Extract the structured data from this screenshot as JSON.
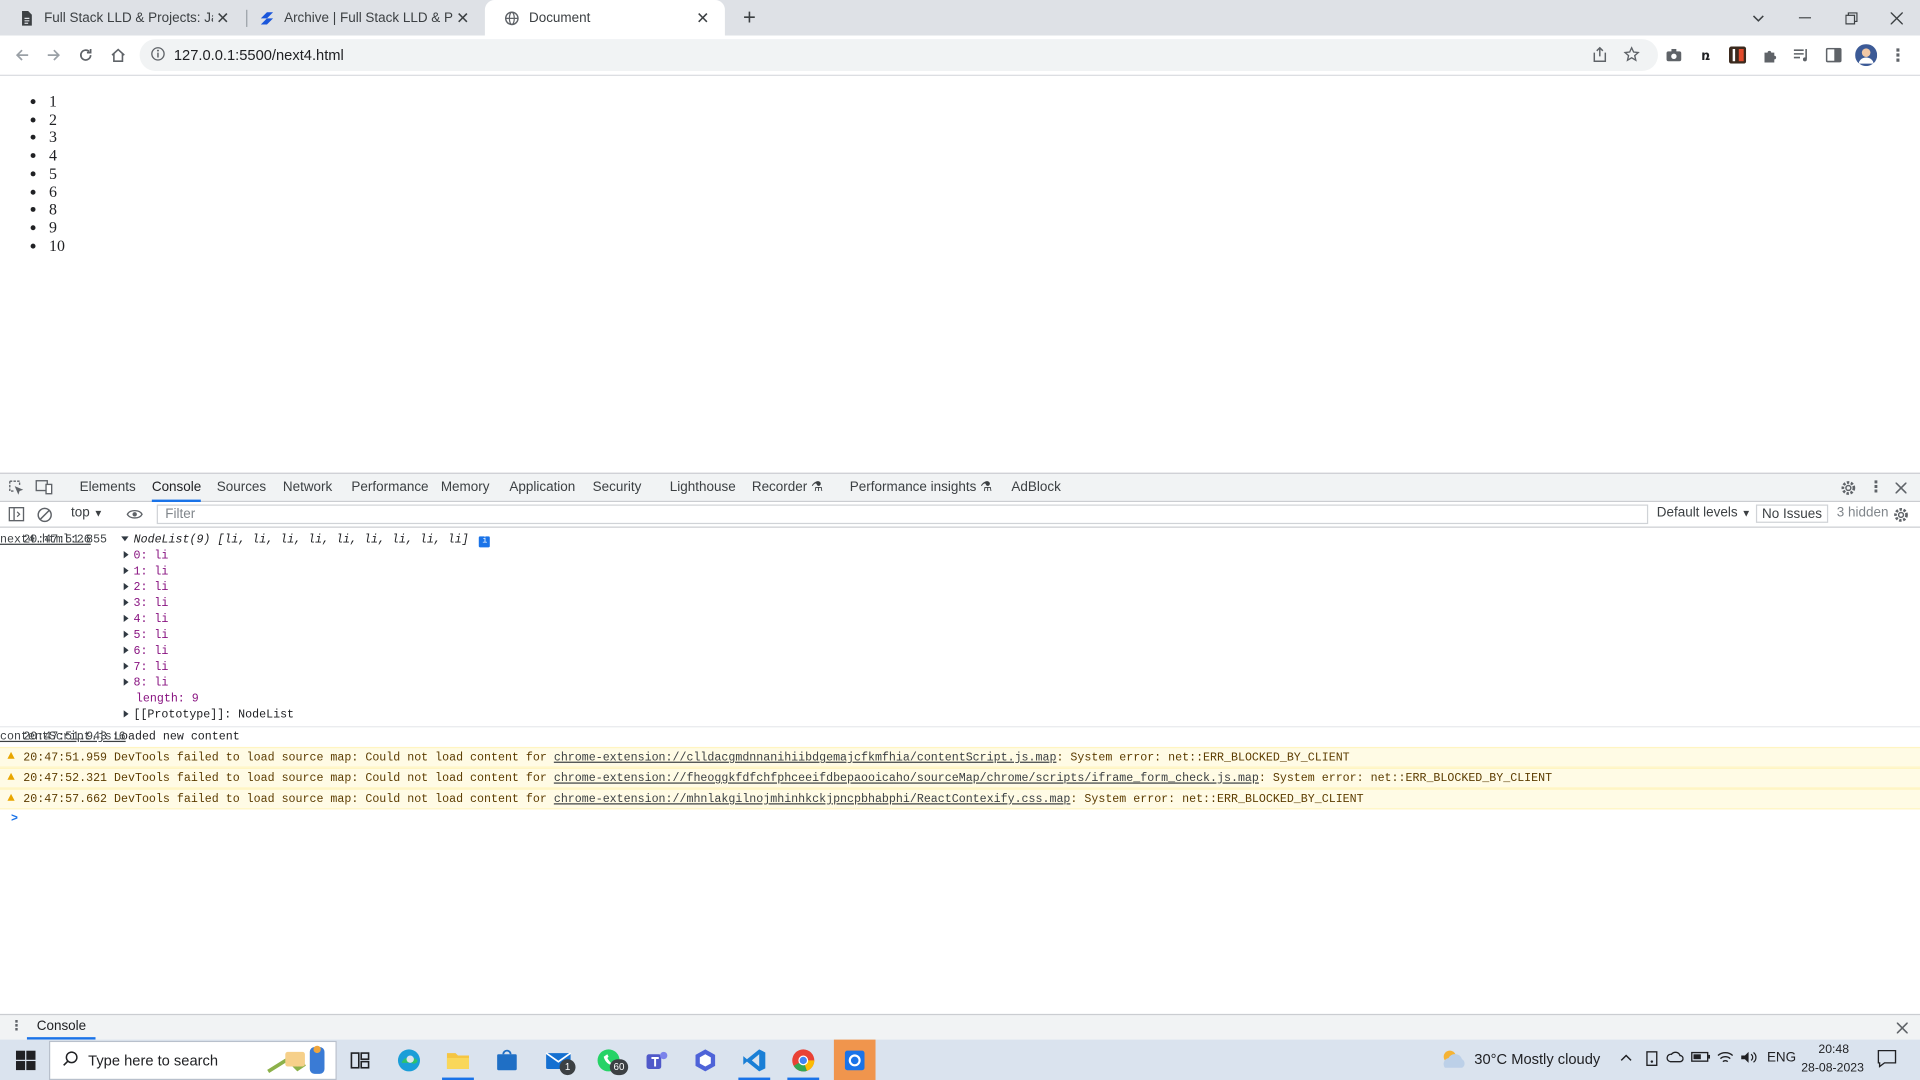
{
  "browser": {
    "tabs": [
      {
        "title": "Full Stack LLD & Projects: JavaScript",
        "icon": "document-icon"
      },
      {
        "title": "Archive | Full Stack LLD & Projects",
        "icon": "scaler-icon"
      },
      {
        "title": "Document",
        "icon": "globe-icon"
      }
    ],
    "url": "127.0.0.1:5500/next4.html"
  },
  "page": {
    "list_items": [
      "1",
      "2",
      "3",
      "4",
      "5",
      "6",
      "8",
      "9",
      "10"
    ]
  },
  "devtools": {
    "tabs": [
      "Elements",
      "Console",
      "Sources",
      "Network",
      "Performance",
      "Memory",
      "Application",
      "Security",
      "Lighthouse",
      "Recorder",
      "Performance insights",
      "AdBlock"
    ],
    "active_tab": "Console",
    "context": "top",
    "filter_placeholder": "Filter",
    "levels": "Default levels",
    "issues": "No Issues",
    "hidden": "3 hidden",
    "drawer_tab": "Console"
  },
  "console": {
    "nodelist": {
      "time": "20:47:51.855",
      "summary": "NodeList(9) [li, li, li, li, li, li, li, li, li]",
      "info_badge": "i",
      "entries": [
        "0: li",
        "1: li",
        "2: li",
        "3: li",
        "4: li",
        "5: li",
        "6: li",
        "7: li",
        "8: li"
      ],
      "length": "length: 9",
      "prototype": "[[Prototype]]: NodeList",
      "source": "next4.html:26"
    },
    "loaded": {
      "time": "20:47:51.943",
      "text": "Loaded new content",
      "source": "contentScript.js:6"
    },
    "warnings": [
      {
        "time": "20:47:51.959",
        "pre": "DevTools failed to load source map: Could not load content for ",
        "link": "chrome-extension://clldacgmdnnanihiibdgemajcfkmfhia/contentScript.js.map",
        "post": ": System error: net::ERR_BLOCKED_BY_CLIENT"
      },
      {
        "time": "20:47:52.321",
        "pre": "DevTools failed to load source map: Could not load content for ",
        "link": "chrome-extension://fheoggkfdfchfphceeifdbepaooicaho/sourceMap/chrome/scripts/iframe_form_check.js.map",
        "post": ": System error: net::ERR_BLOCKED_BY_CLIENT"
      },
      {
        "time": "20:47:57.662",
        "pre": "DevTools failed to load source map: Could not load content for ",
        "link": "chrome-extension://mhnlakgilnojmhinhkckjpncpbhabphi/ReactContexify.css.map",
        "post": ": System error: net::ERR_BLOCKED_BY_CLIENT"
      }
    ],
    "prompt": ">"
  },
  "taskbar": {
    "search_placeholder": "Type here to search",
    "mail_badge": "1",
    "whatsapp_badge": "60",
    "weather": "30°C  Mostly cloudy",
    "lang": "ENG",
    "time": "20:48",
    "date": "28-08-2023"
  }
}
